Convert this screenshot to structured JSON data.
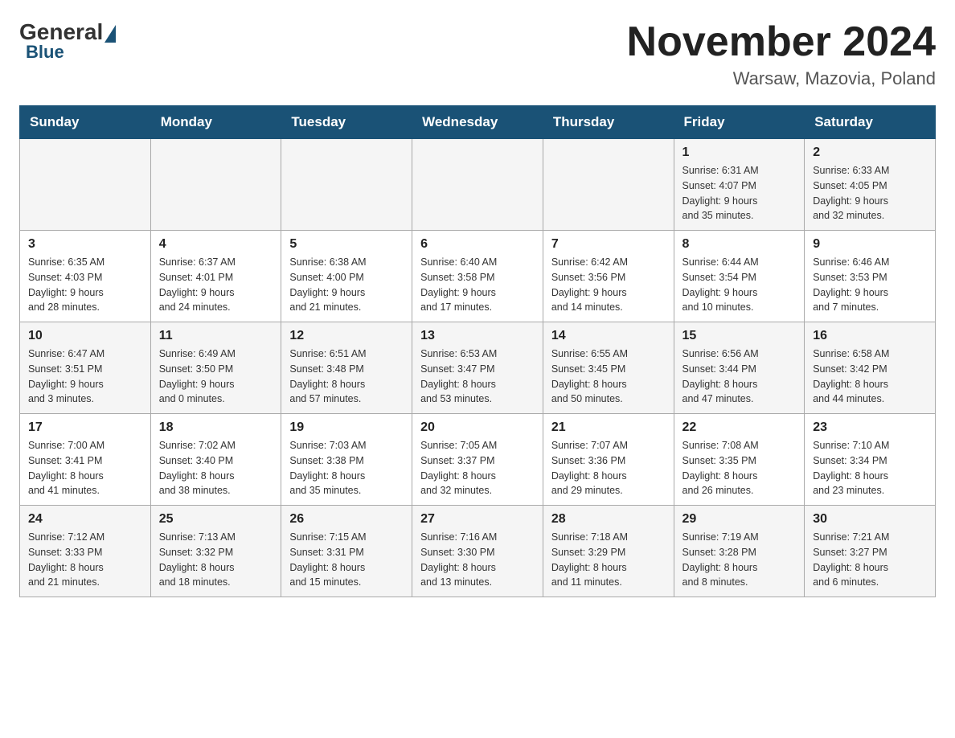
{
  "logo": {
    "general": "General",
    "blue": "Blue"
  },
  "header": {
    "title": "November 2024",
    "location": "Warsaw, Mazovia, Poland"
  },
  "weekdays": [
    "Sunday",
    "Monday",
    "Tuesday",
    "Wednesday",
    "Thursday",
    "Friday",
    "Saturday"
  ],
  "weeks": [
    [
      {
        "day": "",
        "info": ""
      },
      {
        "day": "",
        "info": ""
      },
      {
        "day": "",
        "info": ""
      },
      {
        "day": "",
        "info": ""
      },
      {
        "day": "",
        "info": ""
      },
      {
        "day": "1",
        "info": "Sunrise: 6:31 AM\nSunset: 4:07 PM\nDaylight: 9 hours\nand 35 minutes."
      },
      {
        "day": "2",
        "info": "Sunrise: 6:33 AM\nSunset: 4:05 PM\nDaylight: 9 hours\nand 32 minutes."
      }
    ],
    [
      {
        "day": "3",
        "info": "Sunrise: 6:35 AM\nSunset: 4:03 PM\nDaylight: 9 hours\nand 28 minutes."
      },
      {
        "day": "4",
        "info": "Sunrise: 6:37 AM\nSunset: 4:01 PM\nDaylight: 9 hours\nand 24 minutes."
      },
      {
        "day": "5",
        "info": "Sunrise: 6:38 AM\nSunset: 4:00 PM\nDaylight: 9 hours\nand 21 minutes."
      },
      {
        "day": "6",
        "info": "Sunrise: 6:40 AM\nSunset: 3:58 PM\nDaylight: 9 hours\nand 17 minutes."
      },
      {
        "day": "7",
        "info": "Sunrise: 6:42 AM\nSunset: 3:56 PM\nDaylight: 9 hours\nand 14 minutes."
      },
      {
        "day": "8",
        "info": "Sunrise: 6:44 AM\nSunset: 3:54 PM\nDaylight: 9 hours\nand 10 minutes."
      },
      {
        "day": "9",
        "info": "Sunrise: 6:46 AM\nSunset: 3:53 PM\nDaylight: 9 hours\nand 7 minutes."
      }
    ],
    [
      {
        "day": "10",
        "info": "Sunrise: 6:47 AM\nSunset: 3:51 PM\nDaylight: 9 hours\nand 3 minutes."
      },
      {
        "day": "11",
        "info": "Sunrise: 6:49 AM\nSunset: 3:50 PM\nDaylight: 9 hours\nand 0 minutes."
      },
      {
        "day": "12",
        "info": "Sunrise: 6:51 AM\nSunset: 3:48 PM\nDaylight: 8 hours\nand 57 minutes."
      },
      {
        "day": "13",
        "info": "Sunrise: 6:53 AM\nSunset: 3:47 PM\nDaylight: 8 hours\nand 53 minutes."
      },
      {
        "day": "14",
        "info": "Sunrise: 6:55 AM\nSunset: 3:45 PM\nDaylight: 8 hours\nand 50 minutes."
      },
      {
        "day": "15",
        "info": "Sunrise: 6:56 AM\nSunset: 3:44 PM\nDaylight: 8 hours\nand 47 minutes."
      },
      {
        "day": "16",
        "info": "Sunrise: 6:58 AM\nSunset: 3:42 PM\nDaylight: 8 hours\nand 44 minutes."
      }
    ],
    [
      {
        "day": "17",
        "info": "Sunrise: 7:00 AM\nSunset: 3:41 PM\nDaylight: 8 hours\nand 41 minutes."
      },
      {
        "day": "18",
        "info": "Sunrise: 7:02 AM\nSunset: 3:40 PM\nDaylight: 8 hours\nand 38 minutes."
      },
      {
        "day": "19",
        "info": "Sunrise: 7:03 AM\nSunset: 3:38 PM\nDaylight: 8 hours\nand 35 minutes."
      },
      {
        "day": "20",
        "info": "Sunrise: 7:05 AM\nSunset: 3:37 PM\nDaylight: 8 hours\nand 32 minutes."
      },
      {
        "day": "21",
        "info": "Sunrise: 7:07 AM\nSunset: 3:36 PM\nDaylight: 8 hours\nand 29 minutes."
      },
      {
        "day": "22",
        "info": "Sunrise: 7:08 AM\nSunset: 3:35 PM\nDaylight: 8 hours\nand 26 minutes."
      },
      {
        "day": "23",
        "info": "Sunrise: 7:10 AM\nSunset: 3:34 PM\nDaylight: 8 hours\nand 23 minutes."
      }
    ],
    [
      {
        "day": "24",
        "info": "Sunrise: 7:12 AM\nSunset: 3:33 PM\nDaylight: 8 hours\nand 21 minutes."
      },
      {
        "day": "25",
        "info": "Sunrise: 7:13 AM\nSunset: 3:32 PM\nDaylight: 8 hours\nand 18 minutes."
      },
      {
        "day": "26",
        "info": "Sunrise: 7:15 AM\nSunset: 3:31 PM\nDaylight: 8 hours\nand 15 minutes."
      },
      {
        "day": "27",
        "info": "Sunrise: 7:16 AM\nSunset: 3:30 PM\nDaylight: 8 hours\nand 13 minutes."
      },
      {
        "day": "28",
        "info": "Sunrise: 7:18 AM\nSunset: 3:29 PM\nDaylight: 8 hours\nand 11 minutes."
      },
      {
        "day": "29",
        "info": "Sunrise: 7:19 AM\nSunset: 3:28 PM\nDaylight: 8 hours\nand 8 minutes."
      },
      {
        "day": "30",
        "info": "Sunrise: 7:21 AM\nSunset: 3:27 PM\nDaylight: 8 hours\nand 6 minutes."
      }
    ]
  ]
}
